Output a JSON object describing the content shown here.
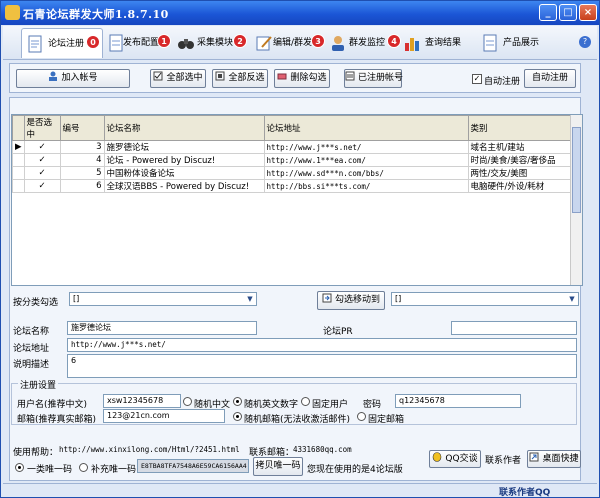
{
  "window": {
    "title": "石青论坛群发大师1.8.7.10",
    "minimize": "_",
    "maximize": "□",
    "close": "×"
  },
  "tabs": [
    {
      "label": "论坛注册",
      "badge": "0"
    },
    {
      "label": "发布配置",
      "badge": "1"
    },
    {
      "label": "采集模块",
      "badge": "2"
    },
    {
      "label": "编辑/群发",
      "badge": "3"
    },
    {
      "label": "群发监控",
      "badge": "4"
    },
    {
      "label": "查询结果"
    },
    {
      "label": "产品展示"
    }
  ],
  "help": "?",
  "actions": {
    "add_account": "加入帐号",
    "select_all": "全部选中",
    "invert_select": "全部反选",
    "clear_select": "删除勾选",
    "registered": "已注册帐号",
    "auto_register_check": "自动注册",
    "auto_register_btn": "自动注册"
  },
  "grid": {
    "columns": [
      "是否选中",
      "编号",
      "论坛名称",
      "论坛地址",
      "类别"
    ],
    "rows": [
      {
        "marker": "▶",
        "checked": "✓",
        "id": "3",
        "name": "施罗德论坛",
        "url": "http://www.j***s.net/",
        "category": "域名主机/建站"
      },
      {
        "marker": "",
        "checked": "✓",
        "id": "4",
        "name": "论坛 -  Powered by Discuz!",
        "url": "http://www.1***ea.com/",
        "category": "时尚/美食/美容/奢侈品"
      },
      {
        "marker": "",
        "checked": "✓",
        "id": "5",
        "name": "中国粉体设备论坛",
        "url": "http://www.sd***n.com/bbs/",
        "category": "两性/交友/美图"
      },
      {
        "marker": "",
        "checked": "✓",
        "id": "6",
        "name": "全球汉语BBS  - Powered by Discuz!",
        "url": "http://bbs.si***ts.com/",
        "category": "电脑硬件/外设/耗材"
      }
    ]
  },
  "filter": {
    "label": "按分类勾选",
    "value": "[]",
    "move_btn": "勾选移动到",
    "target": "[]"
  },
  "detail": {
    "name_label": "论坛名称",
    "name_value": "施罗德论坛",
    "pr_label": "论坛PR",
    "pr_value": "",
    "url_label": "论坛地址",
    "url_value": "http://www.j***s.net/",
    "desc_label": "说明描述",
    "desc_value": "6"
  },
  "register": {
    "group_title": "注册设置",
    "username_label": "用户名(推荐中文)",
    "username_value": "xsw12345678",
    "random_cn": "随机中文",
    "random_en": "随机英文数字",
    "fixed_user": "固定用户",
    "password_label": "密码",
    "password_value": "q12345678",
    "email_label": "邮箱(推荐真实邮箱)",
    "email_value": "123@21cn.com",
    "random_email": "随机邮箱(无法收激活邮件)",
    "fixed_email": "固定邮箱"
  },
  "footer": {
    "help_label": "使用帮助：",
    "help_url": "http://www.xinxilong.com/Html/?2451.html",
    "contact_label": "联系邮箱：",
    "contact_email": "4331680qq.com",
    "opt_one": "一类唯一码",
    "opt_two": "补充唯一码",
    "machine_code": "E8TBA8TFA7548A6E59CA6156AA4",
    "copy_btn": "拷贝唯一码",
    "version_note": "您现在使用的是4论坛版",
    "qq_btn": "QQ交谈",
    "contact_author": "联系作者",
    "desktop_btn": "桌面快捷"
  },
  "status": {
    "text": "联系作者QQ"
  }
}
